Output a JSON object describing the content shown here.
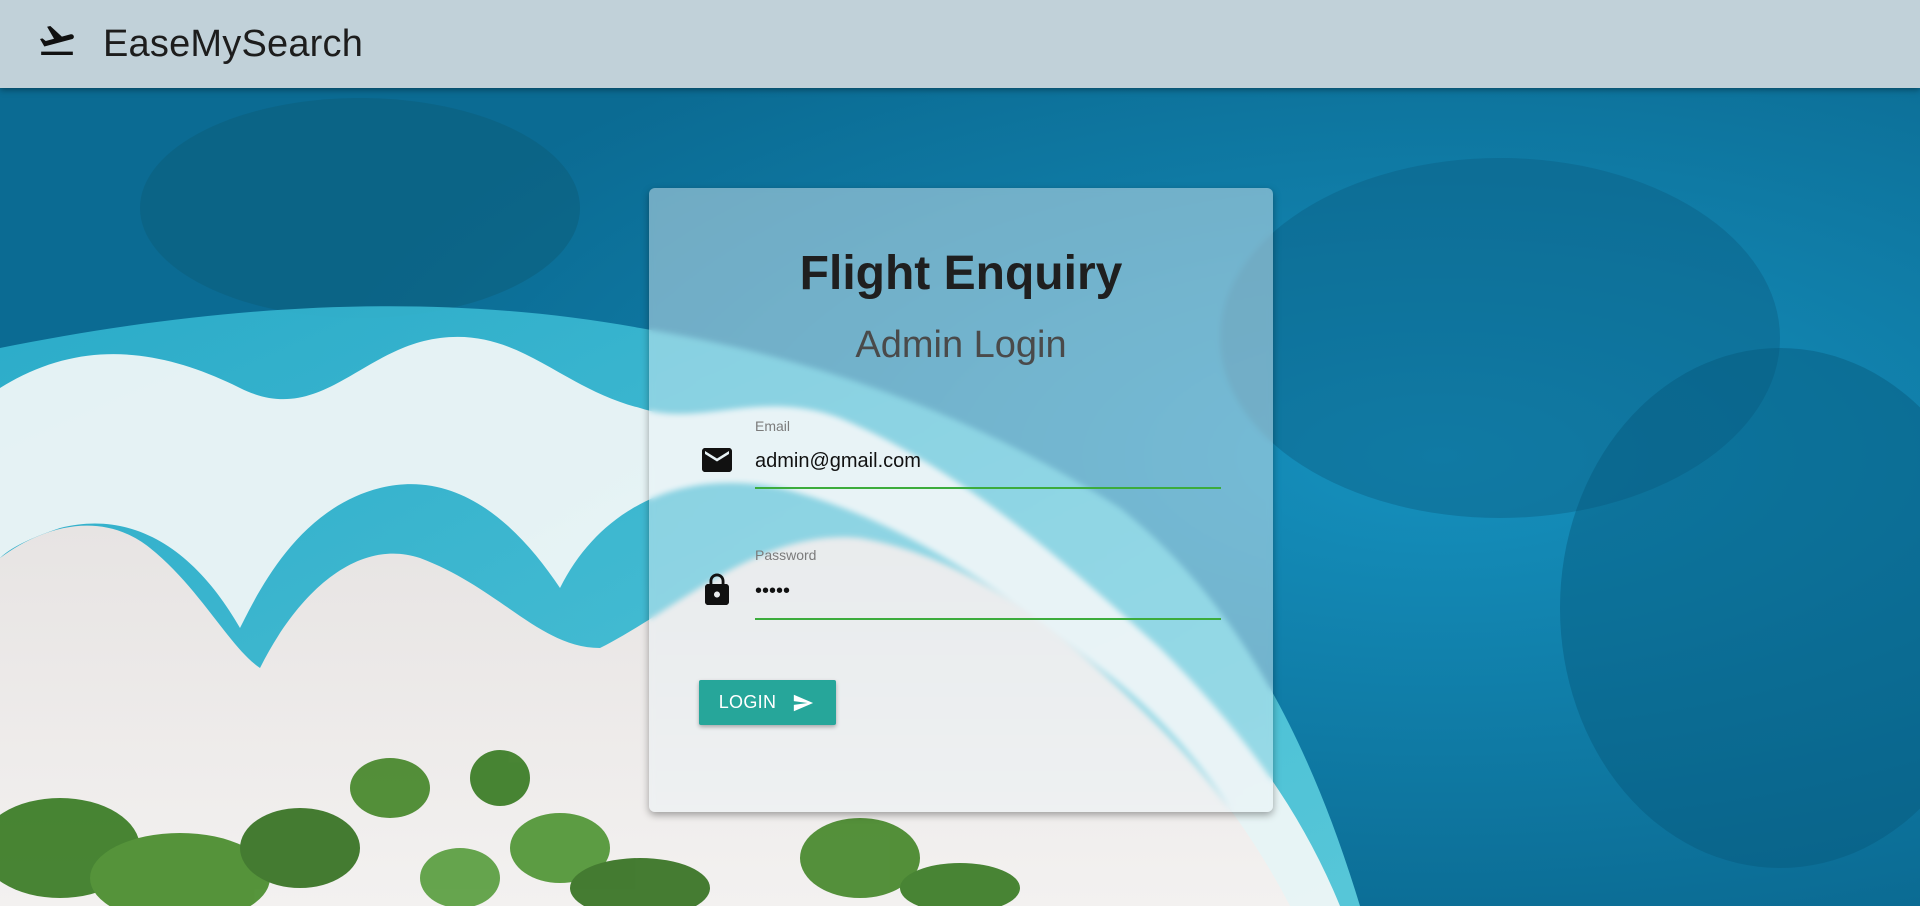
{
  "navbar": {
    "title": "EaseMySearch",
    "icon": "flight-takeoff-icon"
  },
  "card": {
    "title": "Flight Enquiry",
    "subtitle": "Admin Login"
  },
  "form": {
    "email": {
      "label": "Email",
      "value": "admin@gmail.com",
      "icon": "email-icon"
    },
    "password": {
      "label": "Password",
      "value": "admin",
      "icon": "lock-icon"
    },
    "login_button": {
      "label": "LOGIN",
      "icon": "send-icon"
    }
  },
  "colors": {
    "navbar_bg": "#c1d1d9",
    "button_bg": "#26a69a",
    "input_underline": "#3cac3c"
  }
}
